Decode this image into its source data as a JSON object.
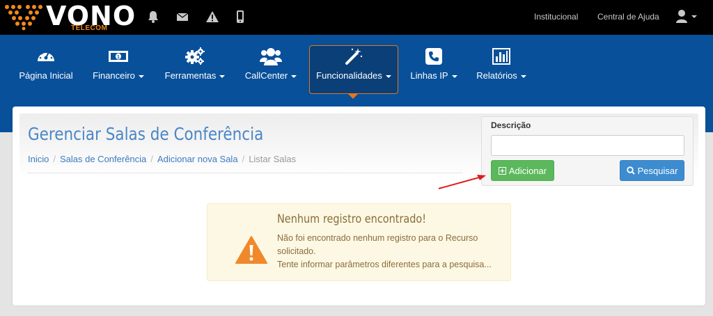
{
  "brand": {
    "name": "VONO",
    "sub": "TELECOM"
  },
  "topbar": {
    "icons": [
      "bell-icon",
      "envelope-icon",
      "warning-icon",
      "mobile-icon"
    ],
    "links": [
      "Institucional",
      "Central de Ajuda"
    ],
    "user_icon": "user-icon"
  },
  "nav": {
    "items": [
      {
        "label": "Página Inicial",
        "icon": "dashboard-icon",
        "dropdown": false
      },
      {
        "label": "Financeiro",
        "icon": "money-icon",
        "dropdown": true
      },
      {
        "label": "Ferramentas",
        "icon": "cogs-icon",
        "dropdown": true
      },
      {
        "label": "CallCenter",
        "icon": "users-icon",
        "dropdown": true
      },
      {
        "label": "Funcionalidades",
        "icon": "magic-wand-icon",
        "dropdown": true,
        "active": true
      },
      {
        "label": "Linhas IP",
        "icon": "phone-icon",
        "dropdown": true
      },
      {
        "label": "Relatórios",
        "icon": "bar-chart-icon",
        "dropdown": true
      }
    ]
  },
  "page": {
    "title": "Gerenciar Salas de Conferência",
    "breadcrumb": [
      "Inicio",
      "Salas de Conferência",
      "Adicionar nova Sala",
      "Listar Salas"
    ]
  },
  "search": {
    "label": "Descrição",
    "value": "",
    "add_label": "Adicionar",
    "search_label": "Pesquisar"
  },
  "alert": {
    "title": "Nenhum registro encontrado!",
    "line1": "Não foi encontrado nenhum registro para o Recurso",
    "line2": "solicitado.",
    "line3": "Tente informar parâmetros diferentes para a pesquisa..."
  },
  "colors": {
    "nav_bg": "#08509a",
    "accent": "#e8751a",
    "success": "#5cb85c",
    "primary": "#3d8cd0",
    "title": "#4a86c5"
  }
}
